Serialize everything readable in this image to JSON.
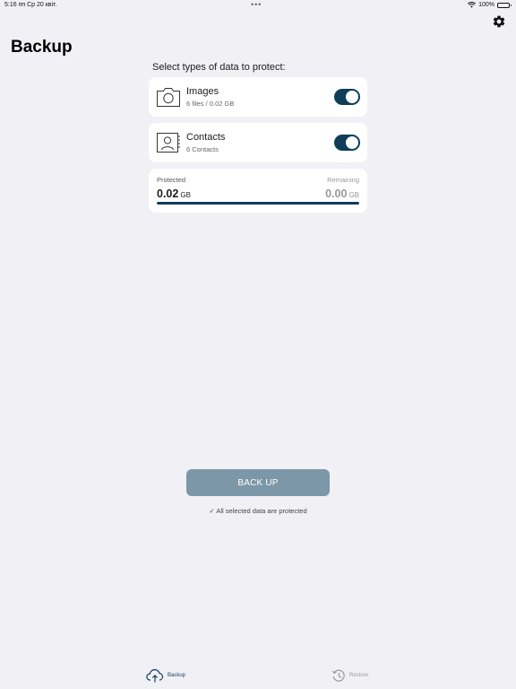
{
  "status_bar": {
    "time_date": "5:16 пп  Ср 20 квіт.",
    "dots": "•••",
    "battery": "100%"
  },
  "header": {
    "title": "Backup"
  },
  "section_title": "Select types of data to protect:",
  "items": [
    {
      "title": "Images",
      "subtitle": "6 files / 0.02 GB",
      "enabled": true,
      "icon": "camera-icon"
    },
    {
      "title": "Contacts",
      "subtitle": "6 Contacts",
      "enabled": true,
      "icon": "contacts-icon"
    }
  ],
  "usage": {
    "protected_label": "Protected",
    "protected_value": "0.02",
    "protected_unit": "GB",
    "remaining_label": "Remaining",
    "remaining_value": "0.00",
    "remaining_unit": "GB",
    "progress": 1.0
  },
  "actions": {
    "backup_label": "BACK UP",
    "status_text": "✓ All selected data are protected"
  },
  "tabs": [
    {
      "label": "Backup",
      "active": true
    },
    {
      "label": "Restore",
      "active": false
    }
  ],
  "colors": {
    "accent": "#0f3e58",
    "button": "#7c97a7",
    "background": "#f1f0f5"
  }
}
